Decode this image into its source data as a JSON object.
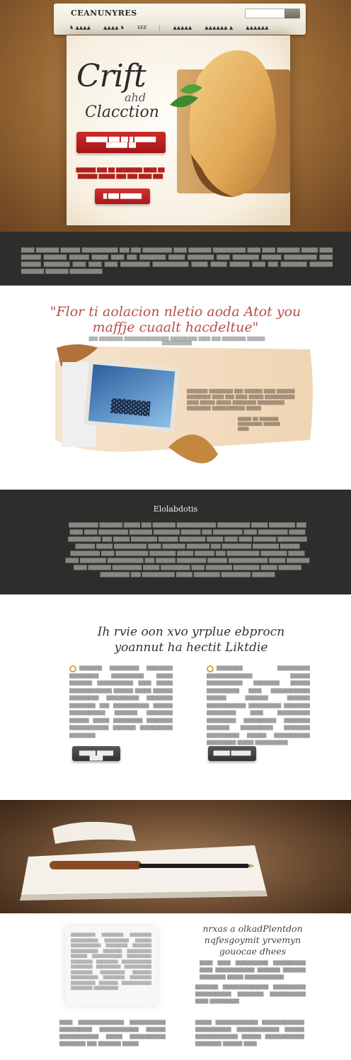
{
  "nav": {
    "logo": "CEANUNYRES",
    "links": [
      "♞ ▲▲▲▲",
      "▲▲▲▲ ♞",
      "EEE",
      "▲▲▲▲▲",
      "▲▲▲▲▲▲ ▲",
      "▲▲▲▲▲▲"
    ],
    "search_placeholder": ""
  },
  "hero": {
    "script_line1": "Crift",
    "script_line2": "ahd",
    "script_line3": "Clacction",
    "cta_text": "██████ ███ ██ █ ██████ ██████ ██",
    "blurb": "██████ ███ ██ ████████ ████ ██ ██████ █████ ███ ███ ████ ███",
    "cta2_text": "█ ███ ██████"
  },
  "band1": {
    "text": "▒▒▒▒ ▒▒▒▒▒▒▒ ▒▒▒▒▒▒ ▒▒▒▒▒▒▒▒▒▒▒ ▒▒▒ ▒▒▒ ▒▒▒▒▒▒▒▒▒ ▒▒▒▒ ▒▒▒▒▒▒▒ ▒▒▒▒▒▒▒▒▒▒ ▒▒▒▒ ▒▒▒▒ ▒▒▒▒▒▒▒ ▒▒▒▒▒ ▒▒▒▒ ▒▒▒▒▒▒ ▒▒▒▒▒▒▒ ▒▒▒▒▒▒ ▒▒▒▒▒ ▒▒▒▒ ▒▒▒ ▒▒▒▒▒▒▒▒ ▒▒▒▒▒ ▒▒▒▒▒▒▒▒ ▒▒▒▒ ▒▒▒▒▒▒▒▒ ▒▒▒▒▒▒ ▒▒▒▒▒▒▒▒▒▒ ▒▒▒▒ ▒▒▒▒▒▒ ▒▒▒▒▒▒▒▒ ▒▒▒▒ ▒▒▒▒ ▒▒▒▒ ▒▒▒▒▒▒▒▒▒ ▒▒▒▒▒▒▒▒▒▒▒ ▒▒▒▒▒ ▒▒▒▒▒ ▒▒▒▒▒▒ ▒▒▒▒ ▒▒▒ ▒▒▒▒▒▒▒▒ ▒▒▒▒▒▒▒ ▒▒▒▒▒▒▒ ▒▒▒▒▒▒▒ ▒▒▒▒▒▒▒▒▒▒"
  },
  "quote": {
    "text": "\"Flor ti aolacion nletio aoda Atot you maffje cuaalt hacdeltue\"",
    "subtext": "▒▒▒ ▒▒▒▒▒▒▒▒ ▒▒▒▒▒▒▒▒▒▒▒▒▒▒▒ ▒▒▒▒▒▒▒▒▒ ▒▒▒▒ ▒▒▒ ▒▒▒▒▒▒▒▒ ▒▒▒▒▒▒ ▒▒▒▒▒▒▒▒▒▒",
    "collage_text": "▒▒▒▒▒▒▒ ▒▒▒▒▒▒▒▒ ▒▒▒ ▒▒▒▒▒▒ ▒▒▒▒ ▒▒▒▒▒▒ ▒▒▒▒▒▒▒▒ ▒▒▒▒ ▒▒▒ ▒▒▒▒ ▒▒▒▒▒ ▒▒▒▒▒▒▒▒▒▒ ▒▒▒▒ ▒▒▒▒▒ ▒▒▒▒▒ ▒▒▒▒▒▒▒▒ ▒▒▒▒▒▒▒▒▒ ▒▒▒▒▒▒▒▒ ▒▒▒▒▒▒▒▒▒▒▒ ▒▒▒▒▒",
    "collage_caption": "▒▒▒▒▒ ▒▒ ▒▒▒▒▒▒▒ ▒▒▒▒▒▒▒▒▒ ▒▒▒▒▒▒ ▒▒▒▒"
  },
  "band2": {
    "title": "Elolabdotis",
    "text": "▒▒▒▒▒▒▒▒▒ ▒▒▒▒▒▒▒ ▒▒▒▒▒ ▒▒▒ ▒▒▒▒▒▒▒ ▒▒▒▒▒▒▒▒▒▒▒▒ ▒▒▒▒▒▒▒▒▒▒ ▒▒▒▒▒ ▒▒▒▒▒▒▒▒ ▒▒▒ ▒▒▒▒ ▒▒▒▒ ▒▒▒▒▒▒▒▒▒ ▒▒▒▒▒▒▒ ▒▒▒▒▒▒▒▒ ▒▒▒▒▒▒ ▒▒▒ ▒▒▒▒▒▒▒▒▒ ▒▒▒▒ ▒▒▒▒▒▒▒▒▒ ▒▒▒▒▒ ▒▒▒▒▒▒▒▒▒▒ ▒▒▒ ▒▒▒▒▒ ▒▒▒▒▒▒▒▒ ▒▒▒▒▒▒ ▒▒▒▒▒▒▒▒ ▒▒▒▒▒ ▒▒▒▒ ▒▒▒▒ ▒▒▒▒▒▒▒ ▒▒▒▒▒▒▒▒▒ ▒▒▒▒▒▒ ▒▒▒▒▒ ▒▒▒▒▒▒▒▒▒▒ ▒▒▒▒ ▒▒▒▒▒▒▒ ▒▒▒▒▒▒▒ ▒▒▒ ▒▒▒▒▒▒▒▒▒ ▒▒▒▒▒▒▒▒ ▒▒▒▒▒▒ ▒▒▒▒▒▒▒▒▒ ▒▒▒▒ ▒▒▒▒▒▒▒▒▒▒ ▒▒▒▒▒▒▒▒ ▒▒▒▒▒ ▒▒▒▒▒▒ ▒▒▒ ▒▒▒▒▒▒▒▒▒▒ ▒▒▒▒▒▒▒▒ ▒▒▒▒▒ ▒▒▒▒ ▒▒▒▒▒▒▒▒ ▒▒▒▒▒▒▒▒▒▒▒ ▒▒▒ ▒▒▒▒▒▒ ▒▒▒▒▒▒▒▒▒ ▒▒▒▒▒▒ ▒▒▒▒▒▒▒▒▒▒▒▒ ▒▒▒▒▒ ▒▒▒▒▒▒▒ ▒▒▒▒ ▒▒▒▒▒▒▒ ▒▒▒▒▒▒▒▒▒ ▒▒▒▒▒ ▒▒▒▒▒▒▒▒▒ ▒▒▒▒ ▒▒▒▒▒▒▒▒ ▒▒▒▒▒▒▒▒ ▒▒▒▒▒ ▒▒▒▒▒▒▒ ▒▒▒▒▒▒▒▒▒ ▒▒▒ ▒▒▒▒▒▒▒▒▒▒ ▒▒▒▒▒ ▒▒▒▒▒▒▒▒ ▒▒▒▒▒▒▒▒▒ ▒▒▒▒▒▒▒"
  },
  "features": {
    "title": "Ih rvie oon xvo yrplue ebprocn yoannut ha hectit Liktdie",
    "left_text": "▒▒▒▒▒▒▒ ▒▒▒▒▒▒▒▒▒ ▒▒▒▒▒▒▒▒ ▒▒▒▒▒▒▒▒▒ ▒▒▒▒▒▒▒▒▒▒ ▒▒▒▒▒ ▒▒▒▒▒▒▒ ▒▒▒▒▒▒▒▒▒▒▒ ▒▒▒▒ ▒▒▒▒▒ ▒▒▒▒▒▒▒▒▒▒▒▒▒ ▒▒▒▒▒▒ ▒▒▒▒▒ ▒▒▒▒▒▒ ▒▒▒▒▒▒▒▒▒ ▒▒▒▒▒▒▒▒▒▒ ▒▒▒▒▒▒▒▒ ▒▒▒▒▒▒▒▒ ▒▒▒ ▒▒▒▒▒▒▒▒▒▒▒ ▒▒▒▒▒▒ ▒▒▒▒▒▒▒▒▒▒▒ ▒▒▒▒▒▒▒ ▒▒▒▒▒▒▒▒ ▒▒▒▒▒▒ ▒▒▒▒▒ ▒▒▒▒▒▒▒▒▒ ▒▒▒▒▒▒▒▒ ▒▒▒▒▒▒▒▒▒▒▒▒ ▒▒▒▒▒▒▒ ▒▒▒▒▒▒▒▒▒▒ ▒▒▒▒▒▒▒▒",
    "right_text": "▒▒▒▒▒▒▒▒ ▒▒▒▒▒▒▒▒▒▒ ▒▒▒▒▒▒▒▒▒▒▒▒▒▒ ▒▒▒▒▒▒ ▒▒▒▒▒▒▒▒▒▒▒ ▒▒▒▒▒▒▒▒ ▒▒▒▒▒▒ ▒▒▒▒▒▒▒▒▒▒ ▒▒▒▒ ▒▒▒▒▒▒▒▒▒▒▒▒ ▒▒▒▒▒▒ ▒▒▒▒▒▒▒ ▒▒▒▒▒▒▒ ▒▒▒▒▒▒▒▒▒▒▒▒ ▒▒▒▒▒▒▒▒▒▒ ▒▒▒▒▒▒▒▒ ▒▒▒▒▒▒▒▒▒ ▒▒▒▒ ▒▒▒▒▒▒▒▒▒▒ ▒▒▒▒▒▒▒▒▒ ▒▒▒▒▒▒▒▒▒▒ ▒▒▒▒▒▒▒▒ ▒▒▒▒▒▒▒ ▒▒▒▒▒▒▒▒▒▒ ▒▒▒▒▒▒▒▒ ▒▒▒▒▒▒▒▒▒▒ ▒▒▒▒▒▒ ▒▒▒▒▒▒▒▒▒▒▒ ▒▒▒▒▒▒▒▒▒ ▒▒▒▒▒ ▒▒▒▒▒▒▒▒▒▒",
    "left_button": "█████ █████ ████",
    "right_button": "█████ ██████"
  },
  "bottom": {
    "title": "nrxas a olkadPlentdon nqfesgoymit yrvemyn gouocae dhees",
    "clip_text": "▒▒▒▒▒▒▒▒▒ ▒▒▒▒▒▒▒▒ ▒▒▒▒▒▒▒▒ ▒▒▒▒▒▒▒▒▒▒ ▒▒▒▒▒▒▒▒▒ ▒▒▒▒▒▒ ▒▒▒▒▒▒▒▒▒▒▒ ▒▒▒▒▒▒▒▒ ▒▒▒▒▒▒▒ ▒▒▒▒▒▒▒▒▒▒ ▒▒▒▒▒▒▒ ▒▒▒▒▒▒▒▒▒ ▒▒▒▒▒▒ ▒▒▒▒▒▒▒▒▒▒▒ ▒▒▒▒▒▒▒▒▒ ▒▒▒▒▒▒▒▒ ▒▒▒▒▒▒▒▒ ▒▒▒▒▒▒▒▒▒▒▒ ▒▒▒▒▒▒▒▒ ▒▒▒▒▒▒▒▒▒ ▒▒▒▒▒▒▒▒▒▒ ▒▒▒▒▒▒▒▒ ▒▒▒▒▒▒▒▒▒ ▒▒▒▒▒▒▒ ▒▒▒▒▒▒▒▒▒▒ ▒▒▒▒▒▒▒▒ ▒▒▒▒▒▒▒▒ ▒▒▒▒▒▒▒▒▒ ▒▒▒▒▒▒▒ ▒▒▒▒▒▒▒▒▒▒▒ ▒▒▒▒▒▒▒▒ ▒▒▒▒▒▒▒▒▒",
    "p1": "▒▒▒▒ ▒▒▒▒ ▒▒▒▒▒▒▒▒▒▒ ▒▒▒▒▒▒▒▒▒▒ ▒▒▒▒ ▒▒▒▒▒▒▒▒▒▒▒▒ ▒▒▒▒▒▒▒ ▒▒▒▒▒▒▒ ▒▒▒▒▒▒▒▒ ▒▒▒▒▒ ▒▒▒▒▒▒▒▒▒▒▒▒",
    "p2": "▒▒▒▒▒▒▒ ▒▒▒▒▒▒▒▒▒▒▒▒▒▒ ▒▒▒▒▒▒▒▒▒▒ ▒▒▒▒▒▒▒▒▒▒▒ ▒▒▒▒▒▒▒▒ ▒▒▒▒▒▒▒▒▒▒▒ ▒▒▒▒ ▒▒▒▒▒▒▒▒▒",
    "p3": "▒▒▒▒ ▒▒▒▒▒▒▒▒▒▒▒▒▒▒ ▒▒▒▒▒▒▒▒▒▒▒ ▒▒▒▒▒▒▒▒▒▒ ▒▒▒▒▒▒▒▒▒▒▒▒ ▒▒▒▒▒▒ ▒▒▒▒▒▒▒▒▒▒▒▒ ▒▒▒▒▒ ▒▒▒▒▒▒▒▒▒▒▒ ▒▒▒▒▒▒▒▒ ▒▒▒ ▒▒▒▒▒▒▒ ▒▒▒▒▒",
    "p4": "▒▒▒▒▒ ▒▒▒▒▒▒▒▒▒▒▒▒▒ ▒▒▒▒▒▒▒▒▒▒▒▒▒ ▒▒▒▒▒▒▒▒▒▒▒ ▒▒▒▒▒▒▒▒▒▒▒▒▒ ▒▒▒▒▒▒ ▒▒▒▒▒▒▒▒▒▒▒▒▒ ▒▒▒▒▒▒ ▒▒▒▒▒▒▒▒▒▒▒▒ ▒▒▒▒▒▒▒▒ ▒▒▒▒▒▒ ▒▒▒▒"
  },
  "colors": {
    "accent_red": "#b7211c",
    "dark_band": "#2e2d2c",
    "quote_red": "#b7504a",
    "badge_gold": "#d5a44a"
  },
  "icons": [
    "search-icon",
    "badge-icon",
    "pen-icon",
    "leaf-icon"
  ]
}
